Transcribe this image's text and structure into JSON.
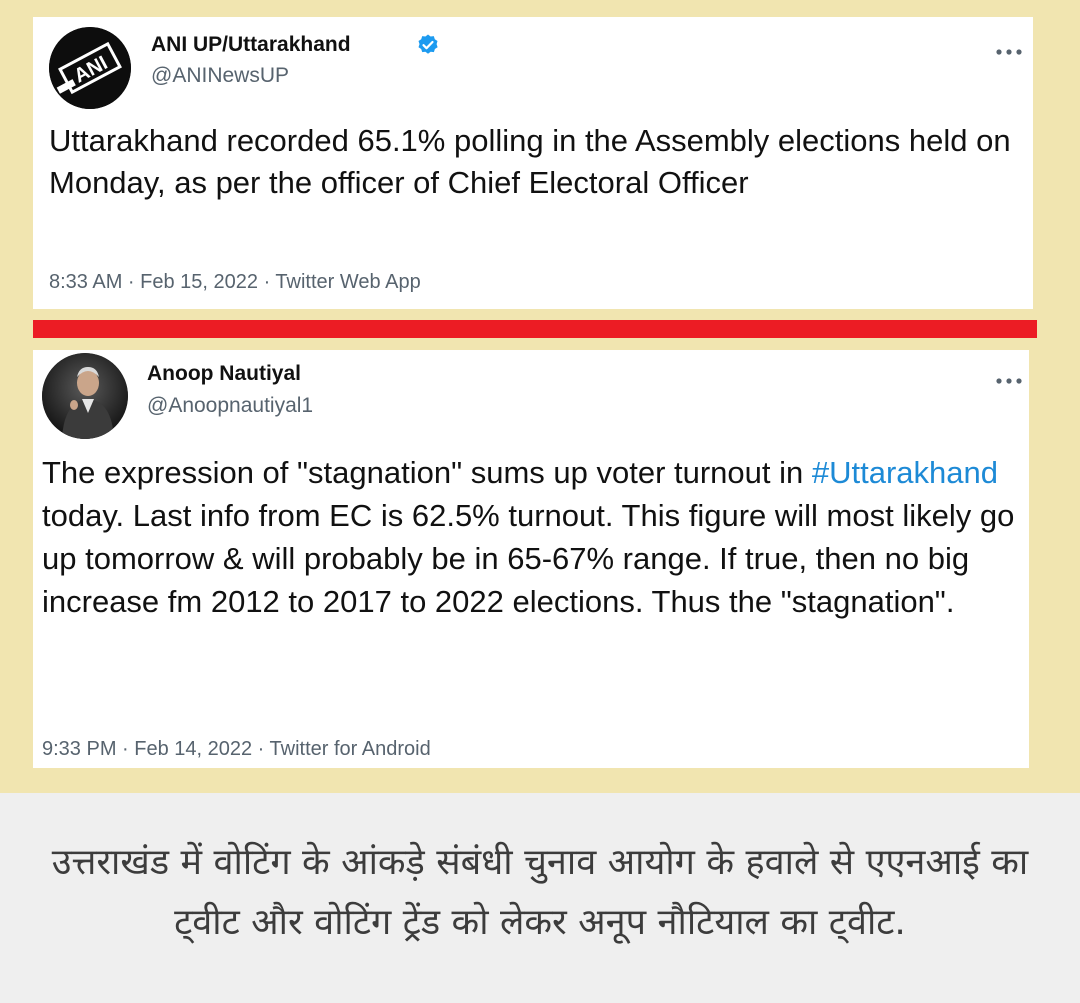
{
  "tweets": [
    {
      "display_name": "ANI UP/Uttarakhand",
      "handle": "@ANINewsUP",
      "verified": true,
      "avatar_icon": "ani-logo-icon",
      "text": "Uttarakhand recorded 65.1% polling in the Assembly elections held on Monday, as per the officer of Chief Electoral Officer",
      "meta": "8:33 AM · Feb 15, 2022 · Twitter Web App"
    },
    {
      "display_name": "Anoop Nautiyal",
      "handle": "@Anoopnautiyal1",
      "verified": false,
      "avatar_icon": "profile-photo-avatar",
      "text_before": "The expression of \"stagnation\" sums up voter turnout in ",
      "hashtag": "#Uttarakhand",
      "text_after": " today. Last info from EC is  62.5% turnout. This figure will most likely go up tomorrow & will probably be in 65-67% range. If true, then no big increase fm 2012 to 2017 to 2022 elections. Thus the \"stagnation\".",
      "meta": "9:33 PM · Feb 14, 2022 · Twitter for Android"
    }
  ],
  "caption": "उत्तराखंड में वोटिंग के आंकड़े संबंधी चुनाव आयोग के हवाले से एएनआई का ट्वीट और वोटिंग ट्रेंड को लेकर अनूप नौटियाल का ट्वीट.",
  "colors": {
    "background": "#f1e5b0",
    "divider": "#ec1c24",
    "hashtag": "#1d8ad6",
    "verified": "#1d9bf0",
    "caption_bg": "#efefef"
  }
}
